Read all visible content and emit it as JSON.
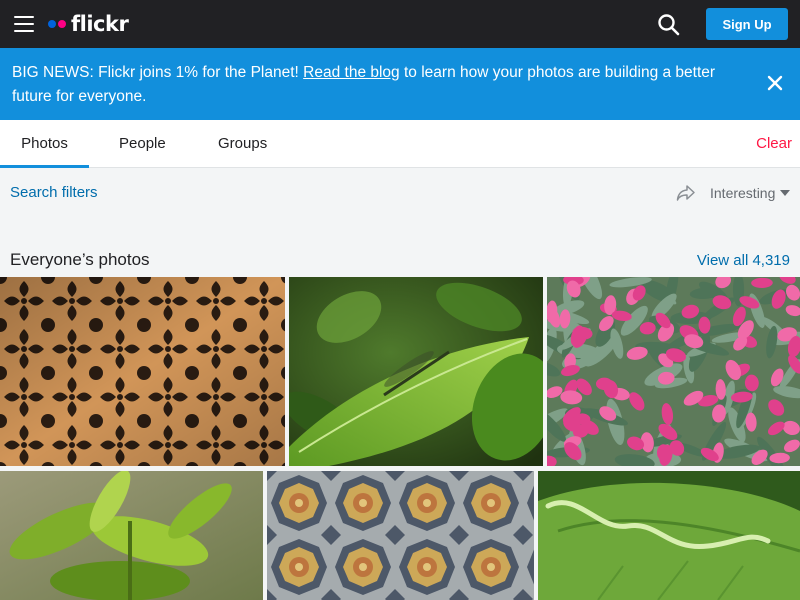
{
  "header": {
    "logo_text": "flickr",
    "signup_label": "Sign Up"
  },
  "banner": {
    "text_before": "BIG NEWS: Flickr joins 1% for the Planet! ",
    "link_text": "Read the blog",
    "text_after": " to learn how your photos are building a better future for everyone."
  },
  "tabs": [
    {
      "label": "Photos",
      "active": true
    },
    {
      "label": "People",
      "active": false
    },
    {
      "label": "Groups",
      "active": false
    }
  ],
  "clear_label": "Clear",
  "filters": {
    "search_filters_label": "Search filters",
    "sort_label": "Interesting"
  },
  "section": {
    "title": "Everyone’s photos",
    "view_all_label": "View all 4,319"
  },
  "photos": [
    {
      "subject": "wooden lattice pattern"
    },
    {
      "subject": "dragonfly on green leaf"
    },
    {
      "subject": "pink tulips bouquet"
    },
    {
      "subject": "green leaves sprout"
    },
    {
      "subject": "mosaic tile floor"
    },
    {
      "subject": "leaf with miner trail"
    }
  ],
  "colors": {
    "topbar": "#212124",
    "accent": "#128fdc",
    "link": "#006dac",
    "clear": "#ff1744"
  }
}
